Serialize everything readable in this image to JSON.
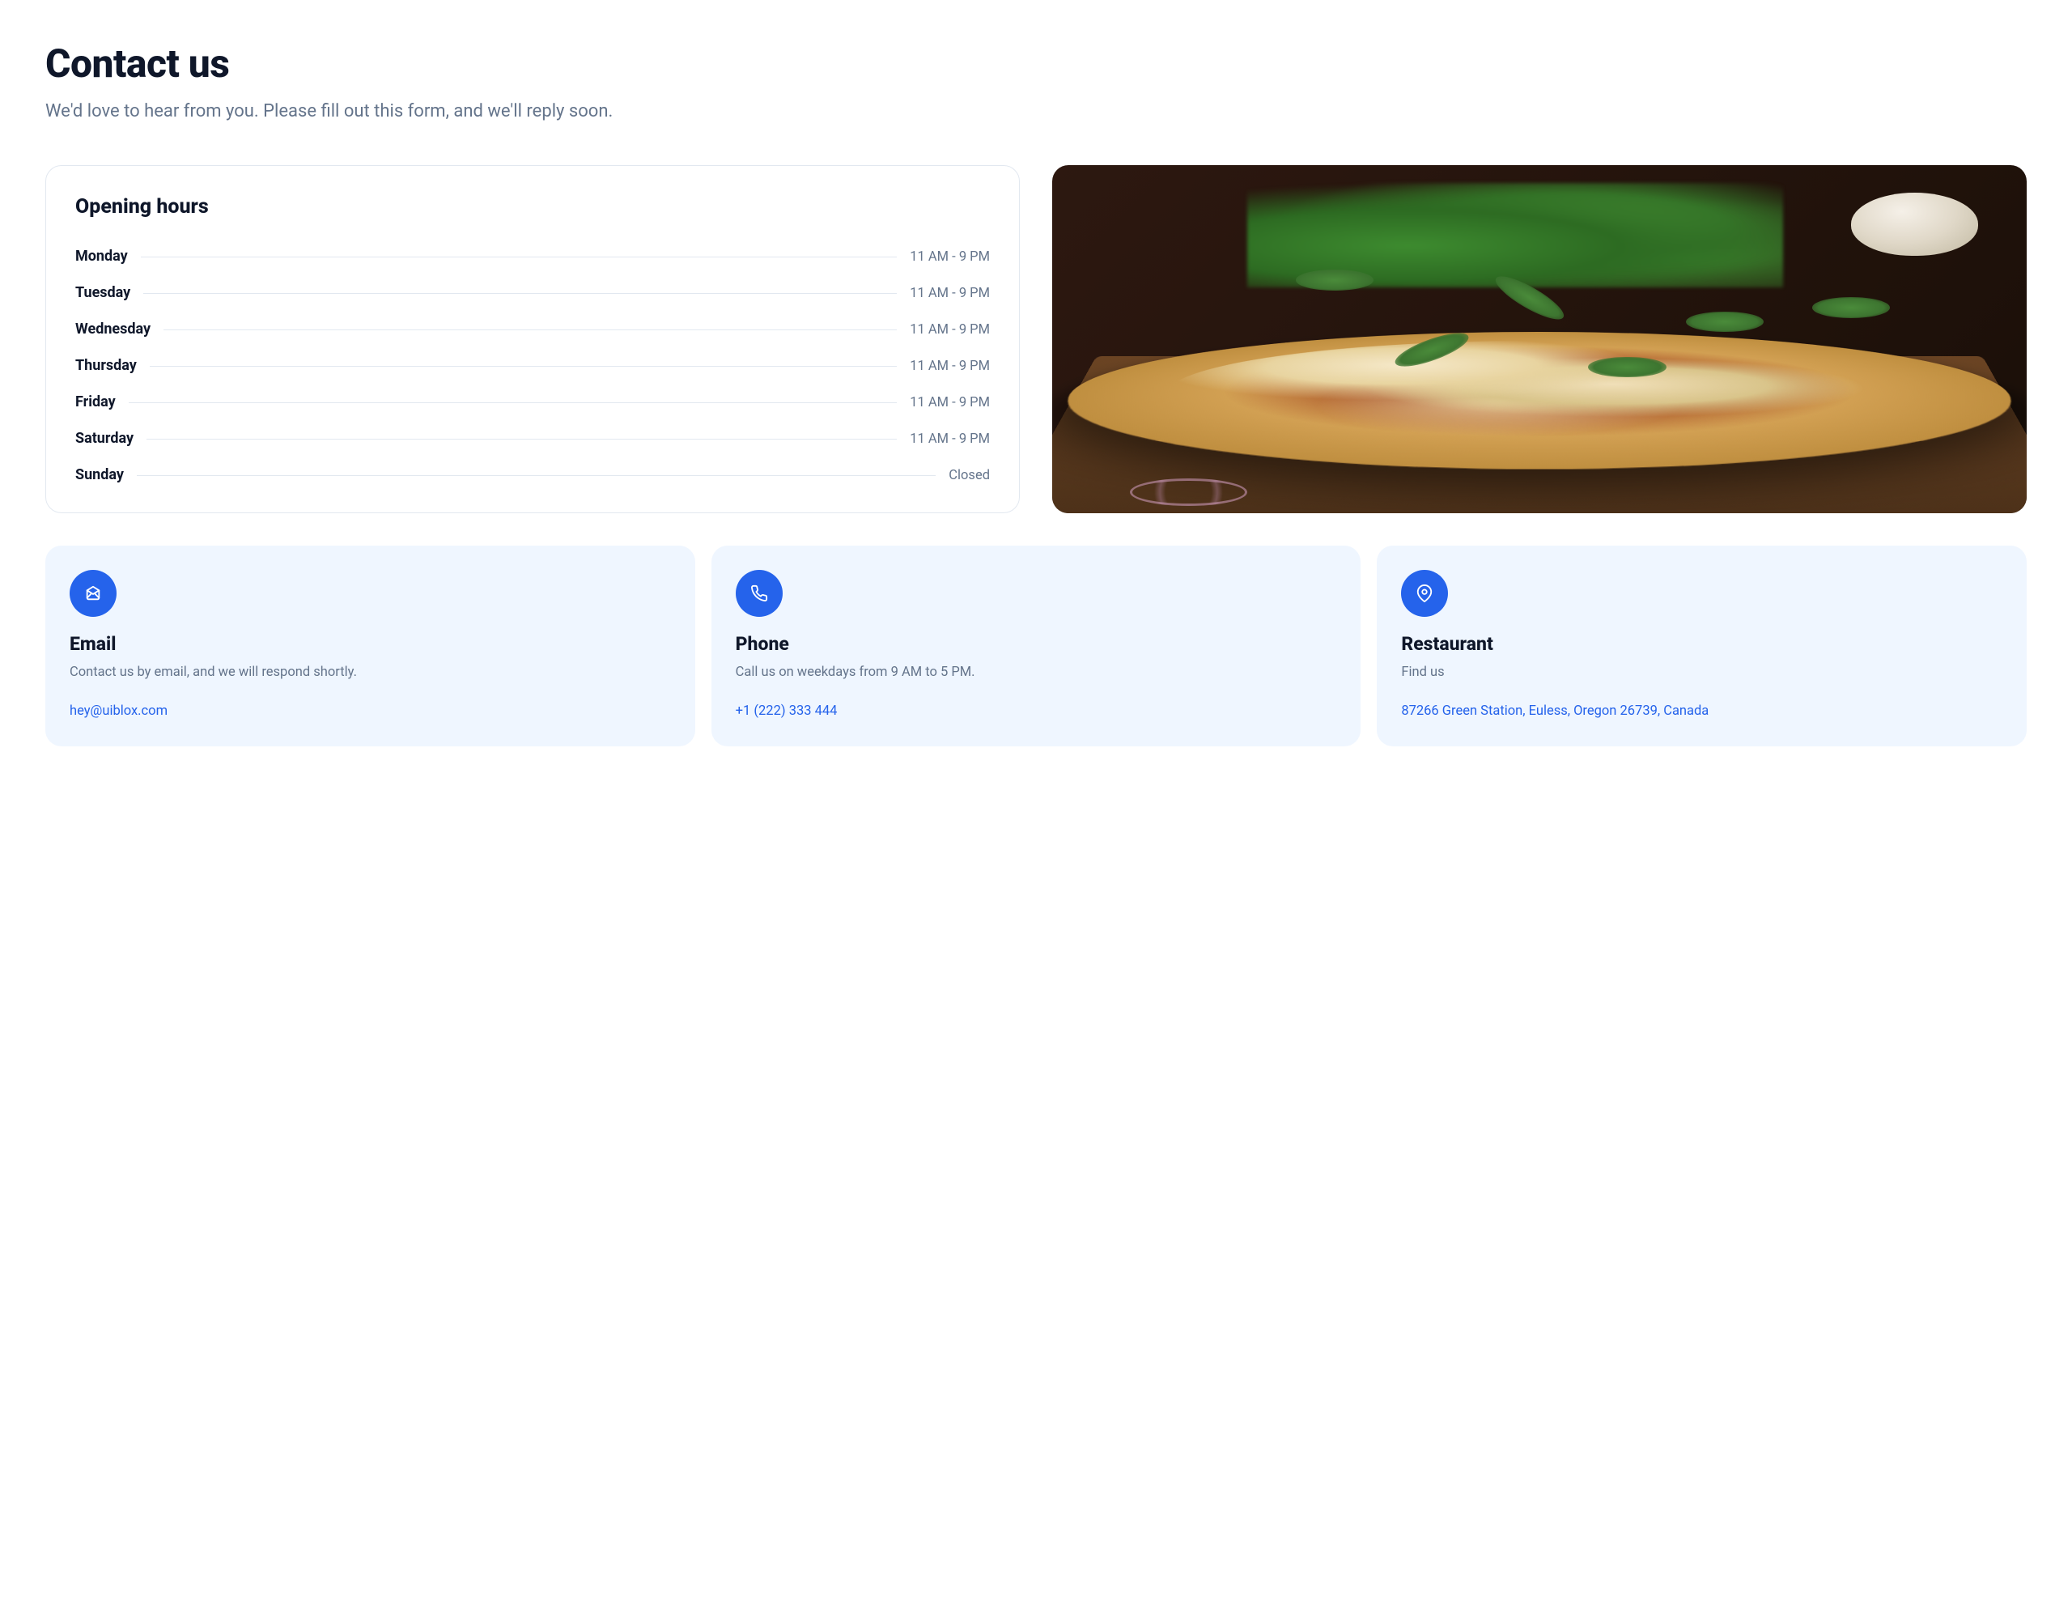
{
  "header": {
    "title": "Contact us",
    "subtitle": "We'd love to hear from you. Please fill out this form, and we'll reply soon."
  },
  "hours": {
    "title": "Opening hours",
    "days": [
      {
        "name": "Monday",
        "time": "11 AM - 9 PM"
      },
      {
        "name": "Tuesday",
        "time": "11 AM - 9 PM"
      },
      {
        "name": "Wednesday",
        "time": "11 AM - 9 PM"
      },
      {
        "name": "Thursday",
        "time": "11 AM - 9 PM"
      },
      {
        "name": "Friday",
        "time": "11 AM - 9 PM"
      },
      {
        "name": "Saturday",
        "time": "11 AM - 9 PM"
      },
      {
        "name": "Sunday",
        "time": "Closed"
      }
    ]
  },
  "cards": {
    "email": {
      "title": "Email",
      "desc": "Contact us by email, and we will respond shortly.",
      "link": "hey@uiblox.com"
    },
    "phone": {
      "title": "Phone",
      "desc": "Call us on weekdays from 9 AM to 5 PM.",
      "link": "+1 (222) 333 444"
    },
    "restaurant": {
      "title": "Restaurant",
      "desc": "Find us",
      "link": "87266 Green Station, Euless, Oregon 26739, Canada"
    }
  }
}
